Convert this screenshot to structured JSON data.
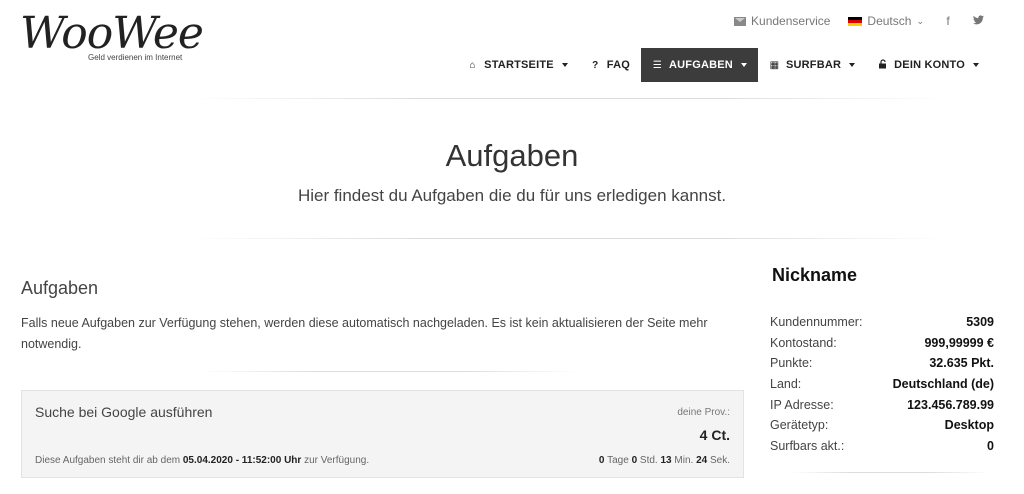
{
  "brand": {
    "logo_text": "WooWee",
    "tagline": "Geld verdienen im Internet"
  },
  "topbar": {
    "support": "Kundenservice",
    "language": "Deutsch",
    "social": [
      {
        "icon": "facebook-icon",
        "glyph": "f"
      },
      {
        "icon": "twitter-icon",
        "glyph": "𝕥"
      }
    ]
  },
  "nav": {
    "items": [
      {
        "label": "STARTSEITE",
        "icon": "home-icon",
        "glyph": "⌂",
        "caret": true
      },
      {
        "label": "FAQ",
        "icon": "question-icon",
        "glyph": "?",
        "caret": false
      },
      {
        "label": "AUFGABEN",
        "icon": "tasks-icon",
        "glyph": "☰",
        "caret": true,
        "active": true
      },
      {
        "label": "SURFBAR",
        "icon": "grid-icon",
        "glyph": "▦",
        "caret": true
      },
      {
        "label": "DEIN KONTO",
        "icon": "unlock-icon",
        "glyph": "🔓",
        "caret": true
      }
    ]
  },
  "hero": {
    "title": "Aufgaben",
    "subtitle": "Hier findest du Aufgaben die du für uns erledigen kannst."
  },
  "main": {
    "title": "Aufgaben",
    "text": "Falls neue Aufgaben zur Verfügung stehen, werden diese automatisch nachgeladen. Es ist kein aktualisieren der Seite mehr notwendig.",
    "task": {
      "title": "Suche bei Google ausführen",
      "prov_label": "deine Prov.:",
      "prov_value": "4 Ct.",
      "avail_prefix": "Diese Aufgaben steht dir ab dem",
      "avail_date": "05.04.2020 - 11:52:00 Uhr",
      "avail_suffix": "zur Verfügung.",
      "countdown": {
        "days": "0",
        "days_label": "Tage",
        "hours": "0",
        "hours_label": "Std.",
        "minutes": "13",
        "minutes_label": "Min.",
        "seconds": "24",
        "seconds_label": "Sek."
      }
    }
  },
  "sidebar": {
    "nickname": "Nickname",
    "stats": [
      {
        "label": "Kundennummer:",
        "value": "5309"
      },
      {
        "label": "Kontostand:",
        "value": "999,99999 €"
      },
      {
        "label": "Punkte:",
        "value": "32.635 Pkt."
      },
      {
        "label": "Land:",
        "value": "Deutschland (de)"
      },
      {
        "label": "IP Adresse:",
        "value": "123.456.789.99"
      },
      {
        "label": "Gerätetyp:",
        "value": "Desktop"
      },
      {
        "label": "Surfbars akt.:",
        "value": "0"
      }
    ]
  },
  "colors": {
    "nav_active_bg": "#3c3c3c",
    "task_bg": "#f4f4f4"
  }
}
